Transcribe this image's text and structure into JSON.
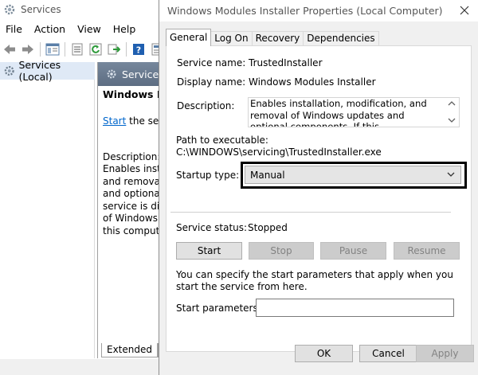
{
  "services": {
    "title": "Services",
    "menu": [
      "File",
      "Action",
      "View",
      "Help"
    ],
    "tree_item": "Services (Local)",
    "detail_header": "Services",
    "detail_title": "Windows Mo",
    "start_link": "Start",
    "start_suffix": " the servi",
    "description_label": "Description:",
    "description_lines": [
      "Enables instal",
      "and removal c",
      "and optional",
      "service is disa",
      "of Windows u",
      "this compute"
    ],
    "tabs": [
      "Extended",
      "S"
    ]
  },
  "dialog": {
    "title": "Windows Modules Installer Properties (Local Computer)",
    "tabs": [
      "General",
      "Log On",
      "Recovery",
      "Dependencies"
    ],
    "service_name_label": "Service name:",
    "service_name": "TrustedInstaller",
    "display_name_label": "Display name:",
    "display_name": "Windows Modules Installer",
    "description_label": "Description:",
    "description": "Enables installation, modification, and removal of Windows updates and optional components. If this",
    "path_label": "Path to executable:",
    "path": "C:\\WINDOWS\\servicing\\TrustedInstaller.exe",
    "startup_type_label": "Startup type:",
    "startup_type": "Manual",
    "service_status_label": "Service status:",
    "service_status": "Stopped",
    "buttons": {
      "start": "Start",
      "stop": "Stop",
      "pause": "Pause",
      "resume": "Resume"
    },
    "params_hint": "You can specify the start parameters that apply when you start the service from here.",
    "params_label": "Start parameters:",
    "params_value": "",
    "footer": {
      "ok": "OK",
      "cancel": "Cancel",
      "apply": "Apply"
    }
  },
  "colors": {
    "highlight_border": "#000000",
    "tree_selection": "#dfe9f6",
    "header_blue": "#6b7c91",
    "link": "#0066cc"
  }
}
